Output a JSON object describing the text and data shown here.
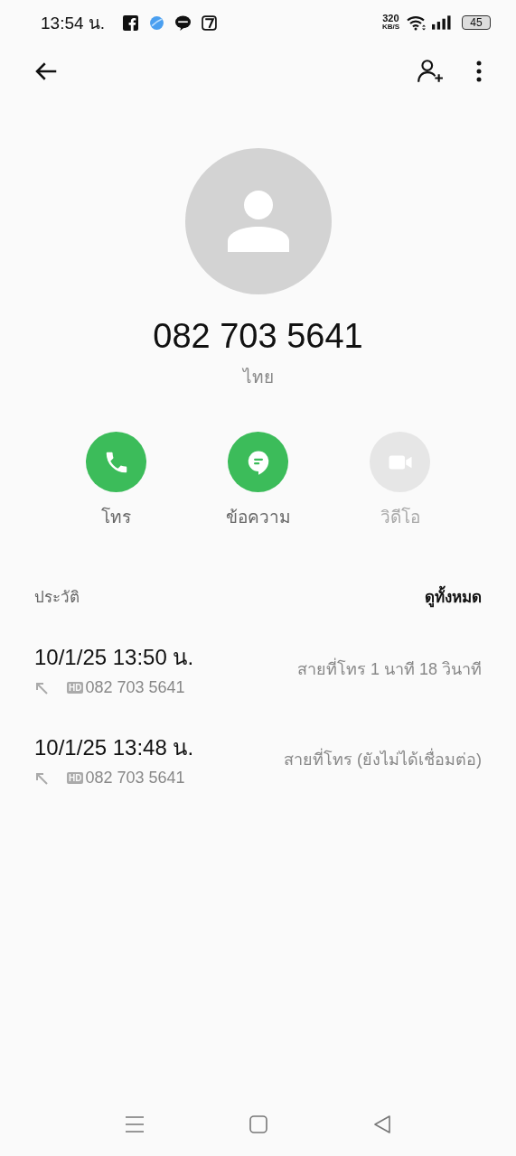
{
  "status_bar": {
    "time": "13:54 น.",
    "speed": "320",
    "speed_unit": "KB/S",
    "battery": "45"
  },
  "contact": {
    "number": "082 703 5641",
    "label": "ไทย"
  },
  "actions": [
    {
      "kind": "call",
      "label": "โทร",
      "disabled": false
    },
    {
      "kind": "message",
      "label": "ข้อความ",
      "disabled": false
    },
    {
      "kind": "video",
      "label": "วิดีโอ",
      "disabled": true
    }
  ],
  "history": {
    "title": "ประวัติ",
    "see_all": "ดูทั้งหมด",
    "rows": [
      {
        "datetime": "10/1/25 13:50 น.",
        "badge": "HD",
        "number": "082 703 5641",
        "detail": "สายที่โทร  1 นาที 18 วินาที"
      },
      {
        "datetime": "10/1/25 13:48 น.",
        "badge": "HD",
        "number": "082 703 5641",
        "detail": "สายที่โทร (ยังไม่ได้เชื่อมต่อ)"
      }
    ]
  }
}
